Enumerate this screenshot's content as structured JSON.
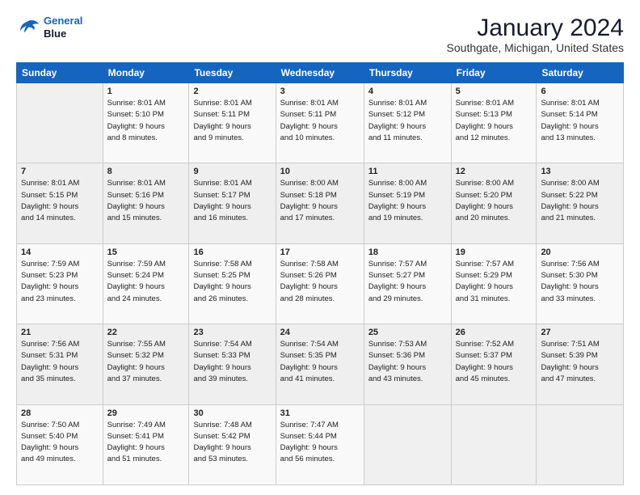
{
  "header": {
    "logo_line1": "General",
    "logo_line2": "Blue",
    "title": "January 2024",
    "subtitle": "Southgate, Michigan, United States"
  },
  "columns": [
    "Sunday",
    "Monday",
    "Tuesday",
    "Wednesday",
    "Thursday",
    "Friday",
    "Saturday"
  ],
  "weeks": [
    [
      {
        "day": "",
        "info": ""
      },
      {
        "day": "1",
        "info": "Sunrise: 8:01 AM\nSunset: 5:10 PM\nDaylight: 9 hours\nand 8 minutes."
      },
      {
        "day": "2",
        "info": "Sunrise: 8:01 AM\nSunset: 5:11 PM\nDaylight: 9 hours\nand 9 minutes."
      },
      {
        "day": "3",
        "info": "Sunrise: 8:01 AM\nSunset: 5:11 PM\nDaylight: 9 hours\nand 10 minutes."
      },
      {
        "day": "4",
        "info": "Sunrise: 8:01 AM\nSunset: 5:12 PM\nDaylight: 9 hours\nand 11 minutes."
      },
      {
        "day": "5",
        "info": "Sunrise: 8:01 AM\nSunset: 5:13 PM\nDaylight: 9 hours\nand 12 minutes."
      },
      {
        "day": "6",
        "info": "Sunrise: 8:01 AM\nSunset: 5:14 PM\nDaylight: 9 hours\nand 13 minutes."
      }
    ],
    [
      {
        "day": "7",
        "info": "Sunrise: 8:01 AM\nSunset: 5:15 PM\nDaylight: 9 hours\nand 14 minutes."
      },
      {
        "day": "8",
        "info": "Sunrise: 8:01 AM\nSunset: 5:16 PM\nDaylight: 9 hours\nand 15 minutes."
      },
      {
        "day": "9",
        "info": "Sunrise: 8:01 AM\nSunset: 5:17 PM\nDaylight: 9 hours\nand 16 minutes."
      },
      {
        "day": "10",
        "info": "Sunrise: 8:00 AM\nSunset: 5:18 PM\nDaylight: 9 hours\nand 17 minutes."
      },
      {
        "day": "11",
        "info": "Sunrise: 8:00 AM\nSunset: 5:19 PM\nDaylight: 9 hours\nand 19 minutes."
      },
      {
        "day": "12",
        "info": "Sunrise: 8:00 AM\nSunset: 5:20 PM\nDaylight: 9 hours\nand 20 minutes."
      },
      {
        "day": "13",
        "info": "Sunrise: 8:00 AM\nSunset: 5:22 PM\nDaylight: 9 hours\nand 21 minutes."
      }
    ],
    [
      {
        "day": "14",
        "info": "Sunrise: 7:59 AM\nSunset: 5:23 PM\nDaylight: 9 hours\nand 23 minutes."
      },
      {
        "day": "15",
        "info": "Sunrise: 7:59 AM\nSunset: 5:24 PM\nDaylight: 9 hours\nand 24 minutes."
      },
      {
        "day": "16",
        "info": "Sunrise: 7:58 AM\nSunset: 5:25 PM\nDaylight: 9 hours\nand 26 minutes."
      },
      {
        "day": "17",
        "info": "Sunrise: 7:58 AM\nSunset: 5:26 PM\nDaylight: 9 hours\nand 28 minutes."
      },
      {
        "day": "18",
        "info": "Sunrise: 7:57 AM\nSunset: 5:27 PM\nDaylight: 9 hours\nand 29 minutes."
      },
      {
        "day": "19",
        "info": "Sunrise: 7:57 AM\nSunset: 5:29 PM\nDaylight: 9 hours\nand 31 minutes."
      },
      {
        "day": "20",
        "info": "Sunrise: 7:56 AM\nSunset: 5:30 PM\nDaylight: 9 hours\nand 33 minutes."
      }
    ],
    [
      {
        "day": "21",
        "info": "Sunrise: 7:56 AM\nSunset: 5:31 PM\nDaylight: 9 hours\nand 35 minutes."
      },
      {
        "day": "22",
        "info": "Sunrise: 7:55 AM\nSunset: 5:32 PM\nDaylight: 9 hours\nand 37 minutes."
      },
      {
        "day": "23",
        "info": "Sunrise: 7:54 AM\nSunset: 5:33 PM\nDaylight: 9 hours\nand 39 minutes."
      },
      {
        "day": "24",
        "info": "Sunrise: 7:54 AM\nSunset: 5:35 PM\nDaylight: 9 hours\nand 41 minutes."
      },
      {
        "day": "25",
        "info": "Sunrise: 7:53 AM\nSunset: 5:36 PM\nDaylight: 9 hours\nand 43 minutes."
      },
      {
        "day": "26",
        "info": "Sunrise: 7:52 AM\nSunset: 5:37 PM\nDaylight: 9 hours\nand 45 minutes."
      },
      {
        "day": "27",
        "info": "Sunrise: 7:51 AM\nSunset: 5:39 PM\nDaylight: 9 hours\nand 47 minutes."
      }
    ],
    [
      {
        "day": "28",
        "info": "Sunrise: 7:50 AM\nSunset: 5:40 PM\nDaylight: 9 hours\nand 49 minutes."
      },
      {
        "day": "29",
        "info": "Sunrise: 7:49 AM\nSunset: 5:41 PM\nDaylight: 9 hours\nand 51 minutes."
      },
      {
        "day": "30",
        "info": "Sunrise: 7:48 AM\nSunset: 5:42 PM\nDaylight: 9 hours\nand 53 minutes."
      },
      {
        "day": "31",
        "info": "Sunrise: 7:47 AM\nSunset: 5:44 PM\nDaylight: 9 hours\nand 56 minutes."
      },
      {
        "day": "",
        "info": ""
      },
      {
        "day": "",
        "info": ""
      },
      {
        "day": "",
        "info": ""
      }
    ]
  ]
}
